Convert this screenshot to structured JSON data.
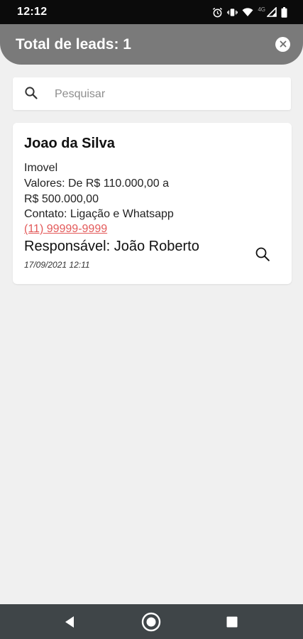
{
  "status_bar": {
    "time": "12:12",
    "network": "4G",
    "icons": [
      "alarm-icon",
      "vibrate-icon",
      "wifi-icon",
      "signal-icon",
      "battery-icon"
    ]
  },
  "header": {
    "title": "Total de leads: 1",
    "close_icon": "close-icon"
  },
  "search": {
    "placeholder": "Pesquisar",
    "value": "",
    "icon": "search-icon"
  },
  "leads": [
    {
      "name": "Joao da Silva",
      "type": "Imovel",
      "values_line1": "Valores: De R$ 110.000,00 a",
      "values_line2": "R$ 500.000,00",
      "contact": "Contato: Ligação e Whatsapp",
      "phone": "(11) 99999-9999",
      "responsible": "Responsável: João Roberto",
      "date": "17/09/2021 12:11",
      "action_icon": "search-icon"
    }
  ],
  "nav_bar": {
    "icons": [
      "back-icon",
      "home-icon",
      "recents-icon"
    ]
  },
  "colors": {
    "header_bg": "#7a7a7a",
    "page_bg": "#f0f0f0",
    "phone_link": "#e35a5a",
    "nav_bg": "#3f4548",
    "status_bg": "#0b0b0b"
  }
}
